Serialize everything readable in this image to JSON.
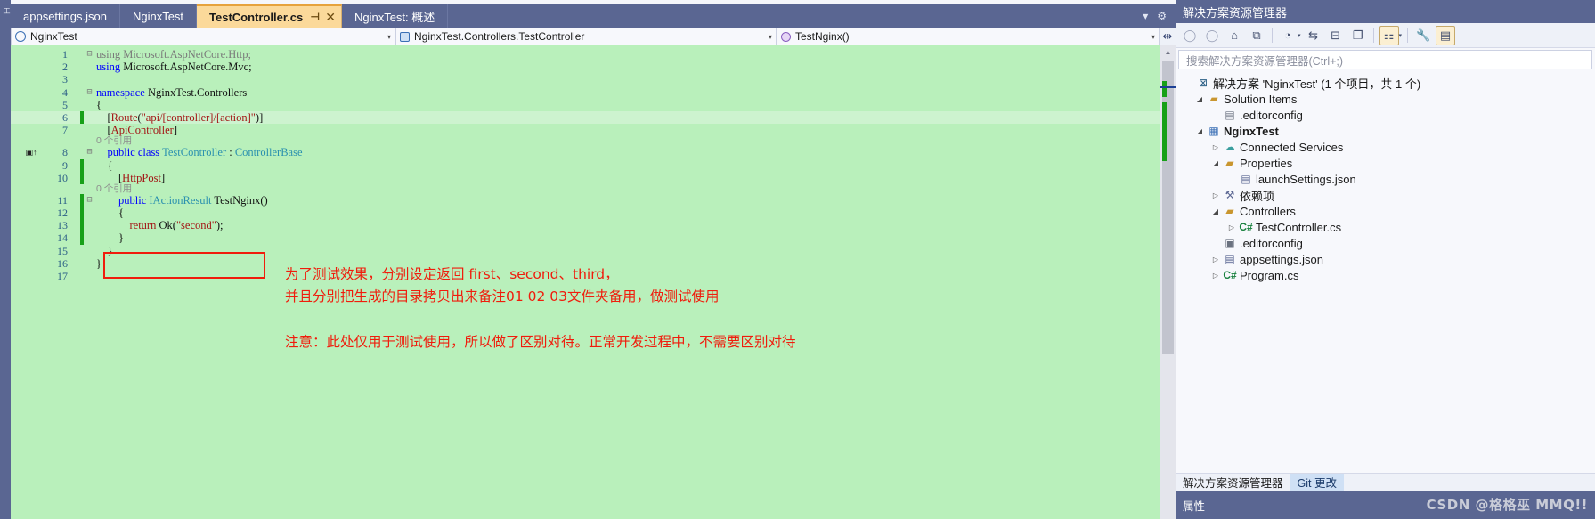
{
  "window": {
    "left_edge_label": "工"
  },
  "tabs": [
    {
      "label": "appsettings.json",
      "active": false
    },
    {
      "label": "NginxTest",
      "active": false
    },
    {
      "label": "TestController.cs",
      "active": true,
      "pin": "⊣",
      "close": "✕"
    },
    {
      "label": "NginxTest: 概述",
      "active": false
    }
  ],
  "tabstrip_right": {
    "caret": "▾",
    "gear": "⚙"
  },
  "navbar": {
    "project": "NginxTest",
    "type": "NginxTest.Controllers.TestController",
    "member": "TestNginx()",
    "caret": "▾",
    "split_icon": "⇹"
  },
  "code": {
    "lines": [
      {
        "n": "1",
        "fold": "⊟",
        "change": false,
        "glyph": "",
        "ref": null,
        "tokens": [
          {
            "t": "using ",
            "c": "t-grey"
          },
          {
            "t": "Microsoft.AspNetCore.Http;",
            "c": "t-grey"
          }
        ]
      },
      {
        "n": "2",
        "fold": "",
        "change": false,
        "glyph": "",
        "ref": null,
        "tokens": [
          {
            "t": "using ",
            "c": "t-kw"
          },
          {
            "t": "Microsoft.AspNetCore.Mvc;",
            "c": "t-ns"
          }
        ]
      },
      {
        "n": "3",
        "fold": "",
        "change": false,
        "glyph": "",
        "ref": null,
        "tokens": []
      },
      {
        "n": "4",
        "fold": "⊟",
        "change": false,
        "glyph": "",
        "ref": null,
        "tokens": [
          {
            "t": "namespace ",
            "c": "t-kw"
          },
          {
            "t": "NginxTest.Controllers",
            "c": "t-ns"
          }
        ]
      },
      {
        "n": "5",
        "fold": "",
        "change": false,
        "glyph": "",
        "ref": null,
        "tokens": [
          {
            "t": "{",
            "c": "t-punc"
          }
        ]
      },
      {
        "n": "6",
        "fold": "",
        "change": true,
        "glyph": "",
        "ref": null,
        "hl": true,
        "tokens": [
          {
            "t": "    [",
            "c": "t-punc"
          },
          {
            "t": "Route",
            "c": "t-attr"
          },
          {
            "t": "(",
            "c": "t-punc"
          },
          {
            "t": "\"api/[controller]/[action]\"",
            "c": "t-str"
          },
          {
            "t": ")]",
            "c": "t-punc"
          }
        ]
      },
      {
        "n": "7",
        "fold": "",
        "change": false,
        "glyph": "",
        "ref": "0 个引用",
        "tokens": [
          {
            "t": "    [",
            "c": "t-punc"
          },
          {
            "t": "ApiController",
            "c": "t-attr"
          },
          {
            "t": "]",
            "c": "t-punc"
          }
        ]
      },
      {
        "n": "8",
        "fold": "⊟",
        "change": false,
        "glyph": "▣↑",
        "ref": null,
        "tokens": [
          {
            "t": "    public class ",
            "c": "t-kw"
          },
          {
            "t": "TestController",
            "c": "t-type"
          },
          {
            "t": " : ",
            "c": "t-punc"
          },
          {
            "t": "ControllerBase",
            "c": "t-type"
          }
        ]
      },
      {
        "n": "9",
        "fold": "",
        "change": true,
        "glyph": "",
        "ref": null,
        "tokens": [
          {
            "t": "    {",
            "c": "t-punc"
          }
        ]
      },
      {
        "n": "10",
        "fold": "",
        "change": true,
        "glyph": "",
        "ref": "0 个引用",
        "tokens": [
          {
            "t": "        [",
            "c": "t-punc"
          },
          {
            "t": "HttpPost",
            "c": "t-attr"
          },
          {
            "t": "]",
            "c": "t-punc"
          }
        ]
      },
      {
        "n": "11",
        "fold": "⊟",
        "change": true,
        "glyph": "",
        "ref": null,
        "tokens": [
          {
            "t": "        public ",
            "c": "t-kw"
          },
          {
            "t": "IActionResult",
            "c": "t-type"
          },
          {
            "t": " TestNginx()",
            "c": "t-id"
          }
        ]
      },
      {
        "n": "12",
        "fold": "",
        "change": true,
        "glyph": "",
        "ref": null,
        "tokens": [
          {
            "t": "        {",
            "c": "t-punc"
          }
        ]
      },
      {
        "n": "13",
        "fold": "",
        "change": true,
        "glyph": "",
        "ref": null,
        "tokens": [
          {
            "t": "            return ",
            "c": "t-attr"
          },
          {
            "t": "Ok(",
            "c": "t-id"
          },
          {
            "t": "\"second\"",
            "c": "t-str"
          },
          {
            "t": ");",
            "c": "t-punc"
          }
        ]
      },
      {
        "n": "14",
        "fold": "",
        "change": true,
        "glyph": "",
        "ref": null,
        "tokens": [
          {
            "t": "        }",
            "c": "t-punc"
          }
        ]
      },
      {
        "n": "15",
        "fold": "",
        "change": false,
        "glyph": "",
        "ref": null,
        "tokens": [
          {
            "t": "    }",
            "c": "t-punc"
          }
        ]
      },
      {
        "n": "16",
        "fold": "",
        "change": false,
        "glyph": "",
        "ref": null,
        "tokens": [
          {
            "t": "}",
            "c": "t-punc"
          }
        ]
      },
      {
        "n": "17",
        "fold": "",
        "change": false,
        "glyph": "",
        "ref": null,
        "tokens": []
      }
    ]
  },
  "annotations": {
    "line1": "为了测试效果，分别设定返回 first、second、third，",
    "line2": "并且分别把生成的目录拷贝出来备注01 02 03文件夹备用，做测试使用",
    "line3": "注意：此处仅用于测试使用，所以做了区别对待。正常开发过程中，不需要区别对待",
    "color": "#f01c0c"
  },
  "scrollbar": {
    "up_arrow": "▲",
    "down_arrow": "▼"
  },
  "solution_explorer": {
    "title": "解决方案资源管理器",
    "search_placeholder": "搜索解决方案资源管理器(Ctrl+;)",
    "toolbar": [
      {
        "name": "back-icon",
        "glyph": "◯",
        "dim": true,
        "boxed": false
      },
      {
        "name": "forward-icon",
        "glyph": "◯",
        "dim": true,
        "boxed": false
      },
      {
        "name": "home-icon",
        "glyph": "⌂",
        "dim": false,
        "boxed": false
      },
      {
        "name": "sync-with-active-document-icon",
        "glyph": "⧉",
        "dim": false,
        "boxed": false
      },
      {
        "name": "pending-changes-filter-icon",
        "glyph": "◔",
        "dim": false,
        "boxed": false,
        "caret": "▾"
      },
      {
        "name": "refresh-icon",
        "glyph": "⇆",
        "dim": false,
        "boxed": false
      },
      {
        "name": "collapse-all-icon",
        "glyph": "⊟",
        "dim": false,
        "boxed": false
      },
      {
        "name": "show-all-files-icon",
        "glyph": "❐",
        "dim": false,
        "boxed": false
      },
      {
        "name": "view-class-view-icon",
        "glyph": "⚏",
        "dim": false,
        "boxed": true,
        "caret": "▾"
      },
      {
        "name": "properties-wrench-icon",
        "glyph": "🔧",
        "dim": false,
        "boxed": false
      },
      {
        "name": "preview-selected-items-icon",
        "glyph": "▤",
        "dim": false,
        "boxed": true
      }
    ],
    "tree": [
      {
        "indent": 0,
        "expander": "",
        "icon": "⊠",
        "icon_class": "ic-sln",
        "label": "解决方案 'NginxTest' (1 个项目，共 1 个)",
        "bold": false
      },
      {
        "indent": 1,
        "expander": "◢",
        "icon": "▰",
        "icon_class": "ic-folder",
        "label": "Solution Items",
        "bold": false
      },
      {
        "indent": 2,
        "expander": "",
        "icon": "▤",
        "icon_class": "ic-file",
        "label": ".editorconfig",
        "bold": false
      },
      {
        "indent": 1,
        "expander": "◢",
        "icon": "▦",
        "icon_class": "ic-proj",
        "label": "NginxTest",
        "bold": true
      },
      {
        "indent": 2,
        "expander": "▷",
        "icon": "☁",
        "icon_class": "ic-cloud",
        "label": "Connected Services",
        "bold": false
      },
      {
        "indent": 2,
        "expander": "◢",
        "icon": "▰",
        "icon_class": "ic-folder",
        "label": "Properties",
        "bold": false
      },
      {
        "indent": 3,
        "expander": "",
        "icon": "▤",
        "icon_class": "ic-json",
        "label": "launchSettings.json",
        "bold": false
      },
      {
        "indent": 2,
        "expander": "▷",
        "icon": "⚒",
        "icon_class": "ic-deps",
        "label": "依赖项",
        "bold": false
      },
      {
        "indent": 2,
        "expander": "◢",
        "icon": "▰",
        "icon_class": "ic-folder",
        "label": "Controllers",
        "bold": false
      },
      {
        "indent": 3,
        "expander": "▷",
        "icon": "C#",
        "icon_class": "ic-cs",
        "label": "TestController.cs",
        "bold": false
      },
      {
        "indent": 2,
        "expander": "",
        "icon": "▣",
        "icon_class": "ic-file",
        "label": ".editorconfig",
        "bold": false
      },
      {
        "indent": 2,
        "expander": "▷",
        "icon": "▤",
        "icon_class": "ic-json",
        "label": "appsettings.json",
        "bold": false
      },
      {
        "indent": 2,
        "expander": "▷",
        "icon": "C#",
        "icon_class": "ic-cs",
        "label": "Program.cs",
        "bold": false
      }
    ],
    "bottom_tabs": [
      {
        "label": "解决方案资源管理器",
        "active": false
      },
      {
        "label": "Git 更改",
        "active": true
      }
    ],
    "properties_label": "属性"
  },
  "watermark": "CSDN @格格巫 MMQ!!"
}
